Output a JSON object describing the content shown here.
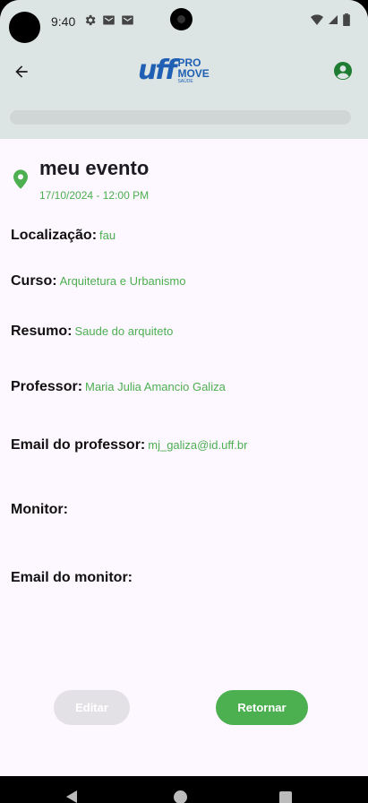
{
  "status_bar": {
    "time": "9:40",
    "icons_left": [
      "gear-icon",
      "mail-icon",
      "mail-icon"
    ],
    "icons_right": [
      "wifi-icon",
      "signal-icon",
      "battery-icon"
    ]
  },
  "app_bar": {
    "logo": {
      "uff": "uff",
      "pro": "PRO",
      "move": "MOVE",
      "sub": "SAÚDE"
    },
    "icons": {
      "back": "arrow-back-icon",
      "account": "account-circle-icon"
    }
  },
  "event": {
    "title": "meu evento",
    "datetime": "17/10/2024 - 12:00 PM",
    "icon": "location-pin-icon"
  },
  "fields": [
    {
      "label": "Localização:",
      "value": "fau"
    },
    {
      "label": "Curso:",
      "value": "Arquitetura e Urbanismo"
    },
    {
      "label": "Resumo:",
      "value": "Saude do arquiteto"
    },
    {
      "label": "Professor:",
      "value": "Maria Julia Amancio Galiza"
    },
    {
      "label": "Email do professor:",
      "value": "mj_galiza@id.uff.br"
    },
    {
      "label": "Monitor:",
      "value": ""
    },
    {
      "label": "Email do monitor:",
      "value": ""
    }
  ],
  "buttons": {
    "edit": {
      "label": "Editar",
      "enabled": false
    },
    "return": {
      "label": "Retornar",
      "enabled": true
    }
  },
  "colors": {
    "accent_green": "#4caf50",
    "header_bg": "#dce5e3",
    "brand_blue": "#1f5fb4",
    "surface": "#fdf7ff"
  }
}
